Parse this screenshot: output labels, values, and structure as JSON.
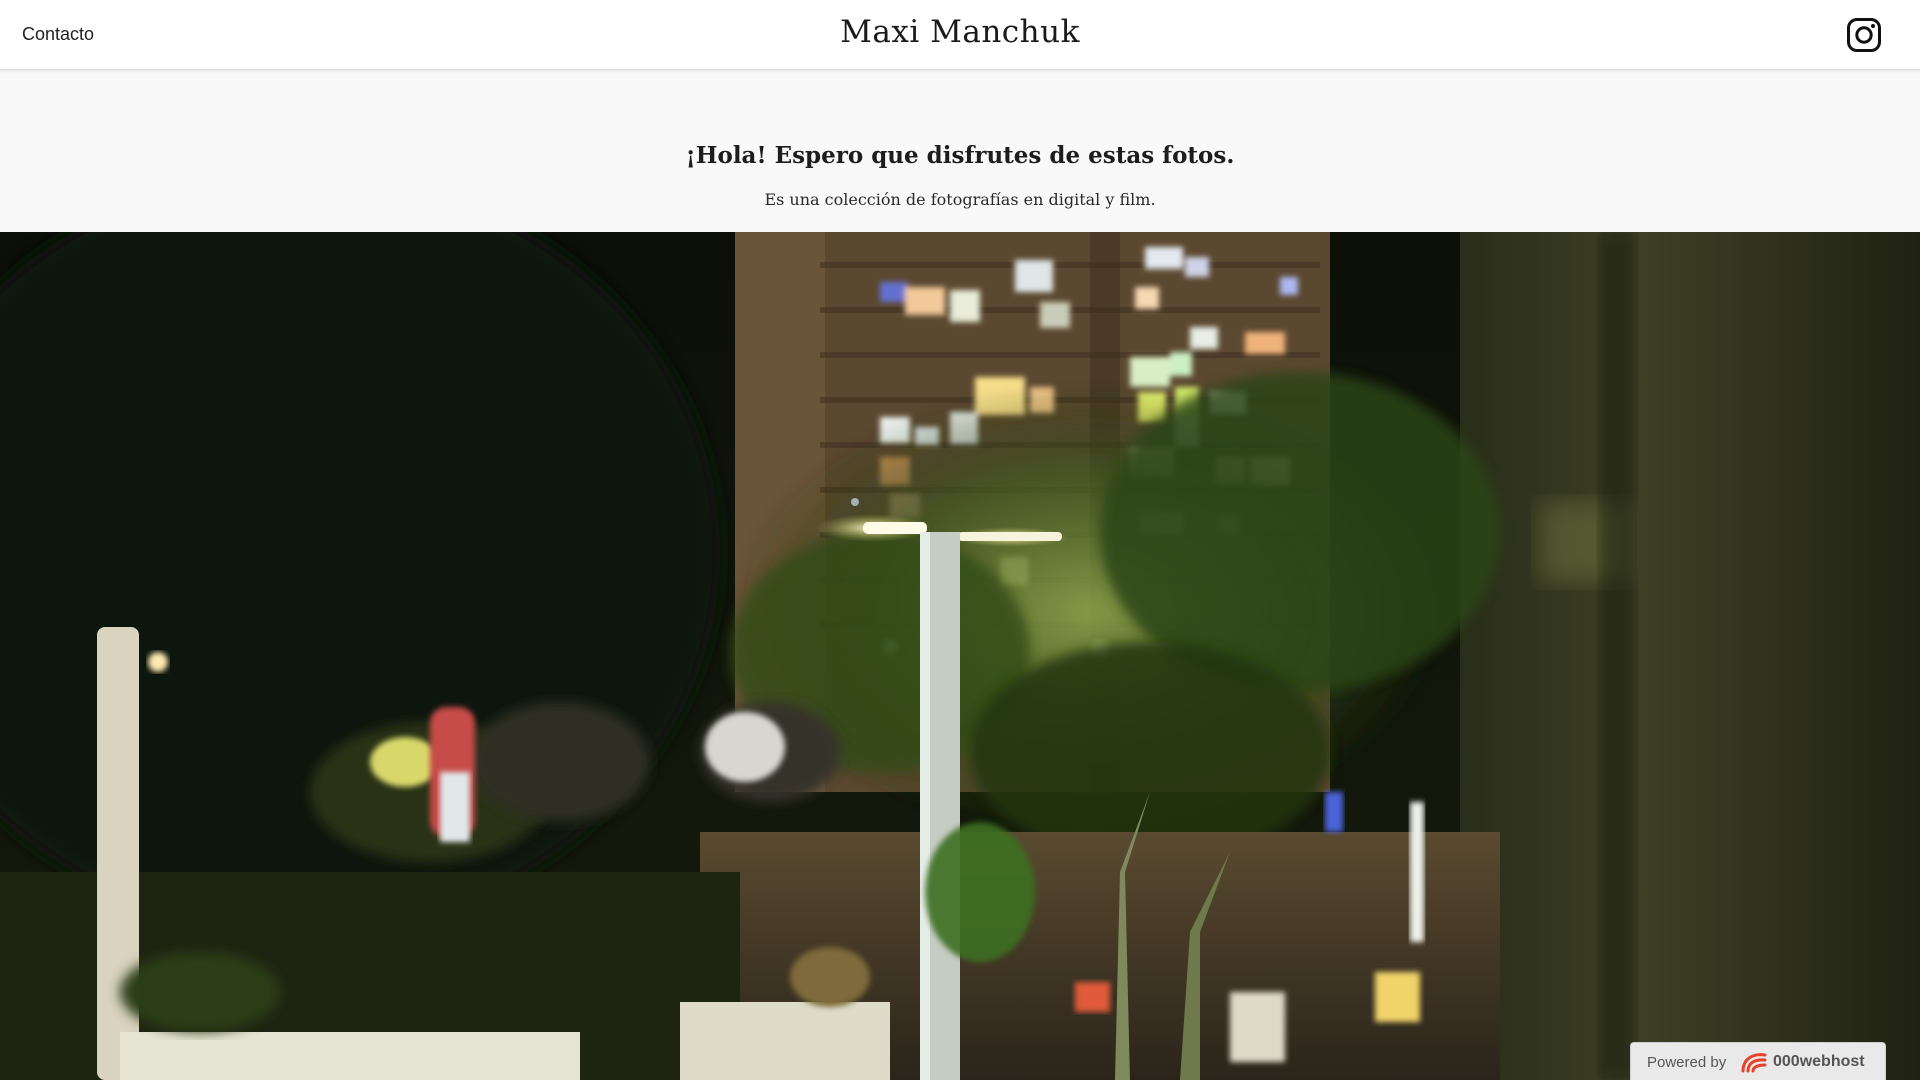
{
  "header": {
    "contact_label": "Contacto",
    "site_title": "Maxi Manchuk",
    "social_icon": "instagram-icon"
  },
  "intro": {
    "heading": "¡Hola! Espero que disfrutes de estas fotos.",
    "subheading": "Es una colección de fotografías en digital y film."
  },
  "hero": {
    "image": "night-street-photo",
    "description_icon": "photo-image"
  },
  "footer_badge": {
    "powered_label": "Powered by",
    "brand": "000webhost",
    "logo_icon": "000webhost-logo-icon"
  },
  "colors": {
    "header_bg": "#ffffff",
    "intro_bg": "#f9f9f9",
    "text": "#1a1a1a",
    "brand_accent": "#e8412c"
  }
}
